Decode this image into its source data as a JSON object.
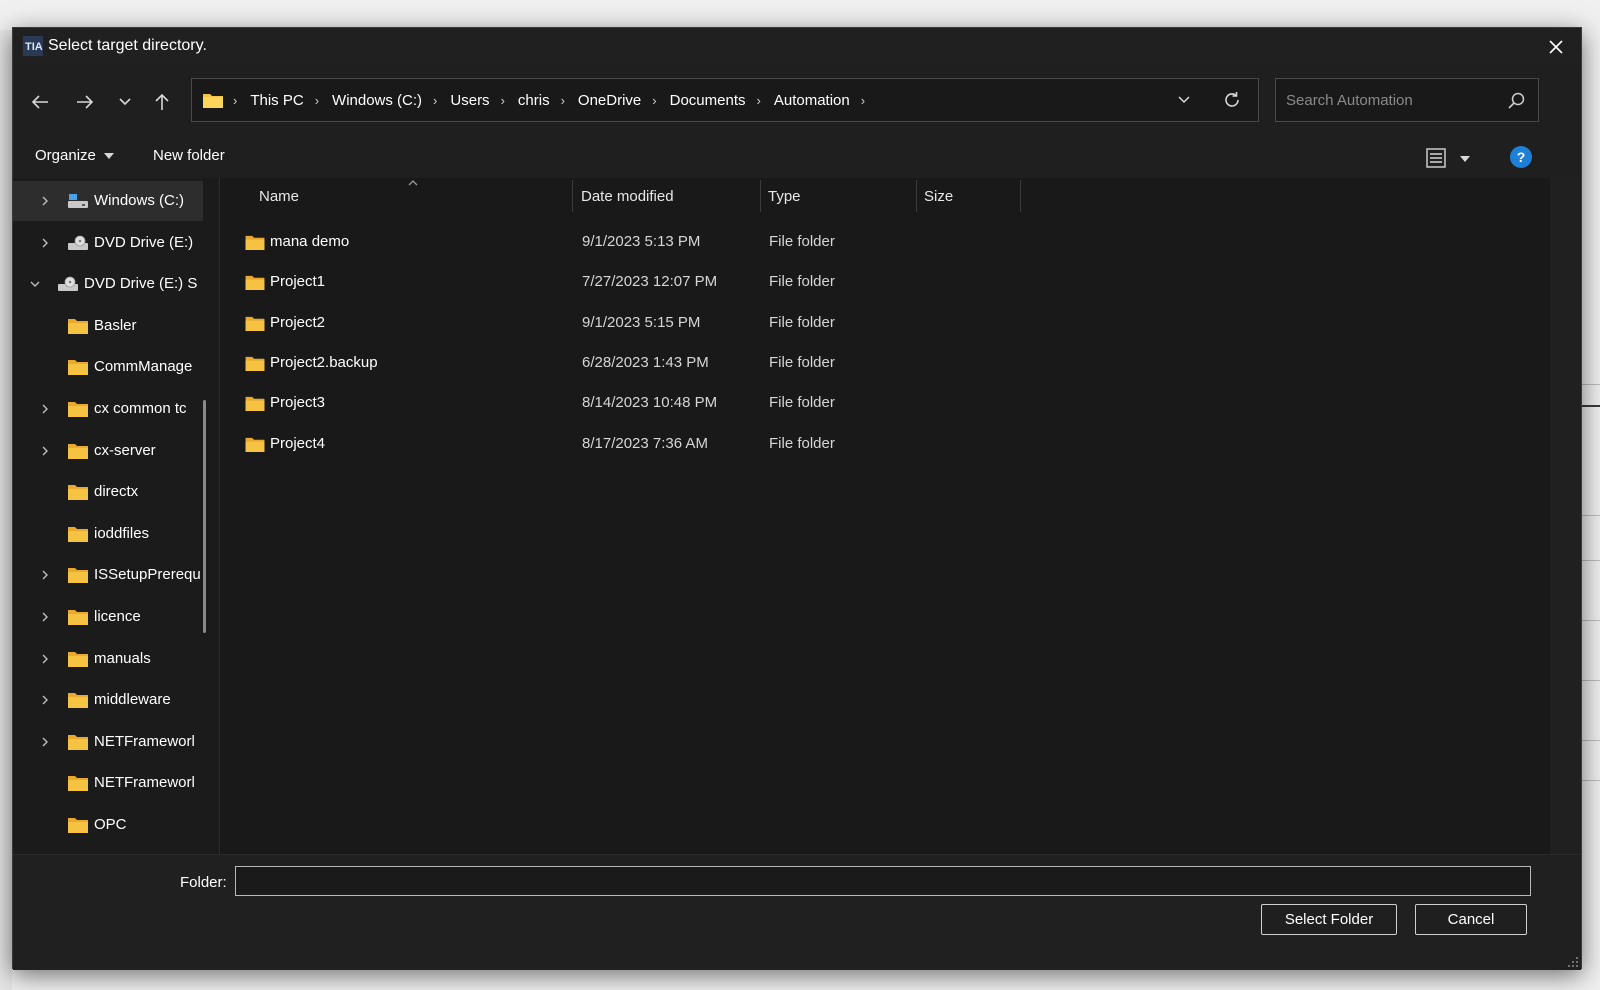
{
  "window": {
    "title": "Select target directory."
  },
  "nav": {
    "breadcrumbs": [
      "This PC",
      "Windows (C:)",
      "Users",
      "chris",
      "OneDrive",
      "Documents",
      "Automation"
    ],
    "search_placeholder": "Search Automation"
  },
  "toolbar": {
    "organize_label": "Organize",
    "new_folder_label": "New folder"
  },
  "tree": [
    {
      "label": "Windows (C:)",
      "icon": "drive-icon",
      "chevron": "right",
      "selected": true
    },
    {
      "label": "DVD Drive (E:)",
      "icon": "dvd-drive-icon",
      "chevron": "right"
    },
    {
      "label": "DVD Drive (E:) S",
      "icon": "dvd-drive-icon",
      "chevron": "down"
    },
    {
      "label": "Basler",
      "icon": "folder-icon",
      "chevron": ""
    },
    {
      "label": "CommManage",
      "icon": "folder-icon",
      "chevron": ""
    },
    {
      "label": "cx common tc",
      "icon": "folder-icon",
      "chevron": "right"
    },
    {
      "label": "cx-server",
      "icon": "folder-icon",
      "chevron": "right"
    },
    {
      "label": "directx",
      "icon": "folder-icon",
      "chevron": ""
    },
    {
      "label": "ioddfiles",
      "icon": "folder-icon",
      "chevron": ""
    },
    {
      "label": "ISSetupPrerequ",
      "icon": "folder-icon",
      "chevron": "right"
    },
    {
      "label": "licence",
      "icon": "folder-icon",
      "chevron": "right"
    },
    {
      "label": "manuals",
      "icon": "folder-icon",
      "chevron": "right"
    },
    {
      "label": "middleware",
      "icon": "folder-icon",
      "chevron": "right"
    },
    {
      "label": "NETFrameworl",
      "icon": "folder-icon",
      "chevron": "right"
    },
    {
      "label": "NETFrameworl",
      "icon": "folder-icon",
      "chevron": ""
    },
    {
      "label": "OPC",
      "icon": "folder-icon",
      "chevron": ""
    }
  ],
  "columns": {
    "name": "Name",
    "date_modified": "Date modified",
    "type": "Type",
    "size": "Size"
  },
  "files": [
    {
      "name": "mana demo",
      "date": "9/1/2023 5:13 PM",
      "type": "File folder"
    },
    {
      "name": "Project1",
      "date": "7/27/2023 12:07 PM",
      "type": "File folder"
    },
    {
      "name": "Project2",
      "date": "9/1/2023 5:15 PM",
      "type": "File folder"
    },
    {
      "name": "Project2.backup",
      "date": "6/28/2023 1:43 PM",
      "type": "File folder"
    },
    {
      "name": "Project3",
      "date": "8/14/2023 10:48 PM",
      "type": "File folder"
    },
    {
      "name": "Project4",
      "date": "8/17/2023 7:36 AM",
      "type": "File folder"
    }
  ],
  "footer": {
    "folder_label": "Folder:",
    "folder_value": "",
    "select_label": "Select Folder",
    "cancel_label": "Cancel"
  },
  "colors": {
    "background": "#202020",
    "folder": "#f5c242",
    "accent": "#1e7fd6"
  }
}
